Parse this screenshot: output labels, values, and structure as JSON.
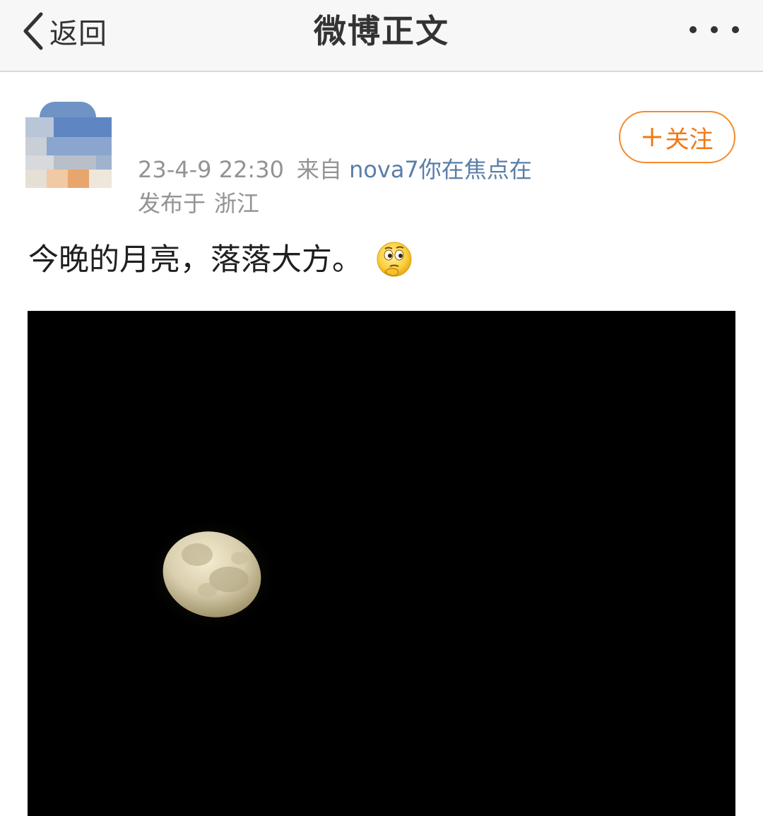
{
  "navbar": {
    "back_label": "返回",
    "title": "微博正文",
    "back_icon": "chevron-left-icon",
    "more_icon": "more-dots-icon"
  },
  "post": {
    "author_name": "",
    "timestamp": "23-4-9 22:30",
    "source_prefix": "来自",
    "source_device": "nova7你在焦点在",
    "location_prefix": "发布于",
    "location": "浙江",
    "follow_label": "关注",
    "follow_icon": "plus-icon",
    "text": "今晚的月亮，落落大方。",
    "emoji": "thinking-emoji",
    "image": "moon-photo"
  },
  "colors": {
    "accent_orange": "#f58a2c",
    "link_blue": "#5a7ea8",
    "meta_gray": "#939393",
    "navbar_bg": "#f7f7f7"
  }
}
